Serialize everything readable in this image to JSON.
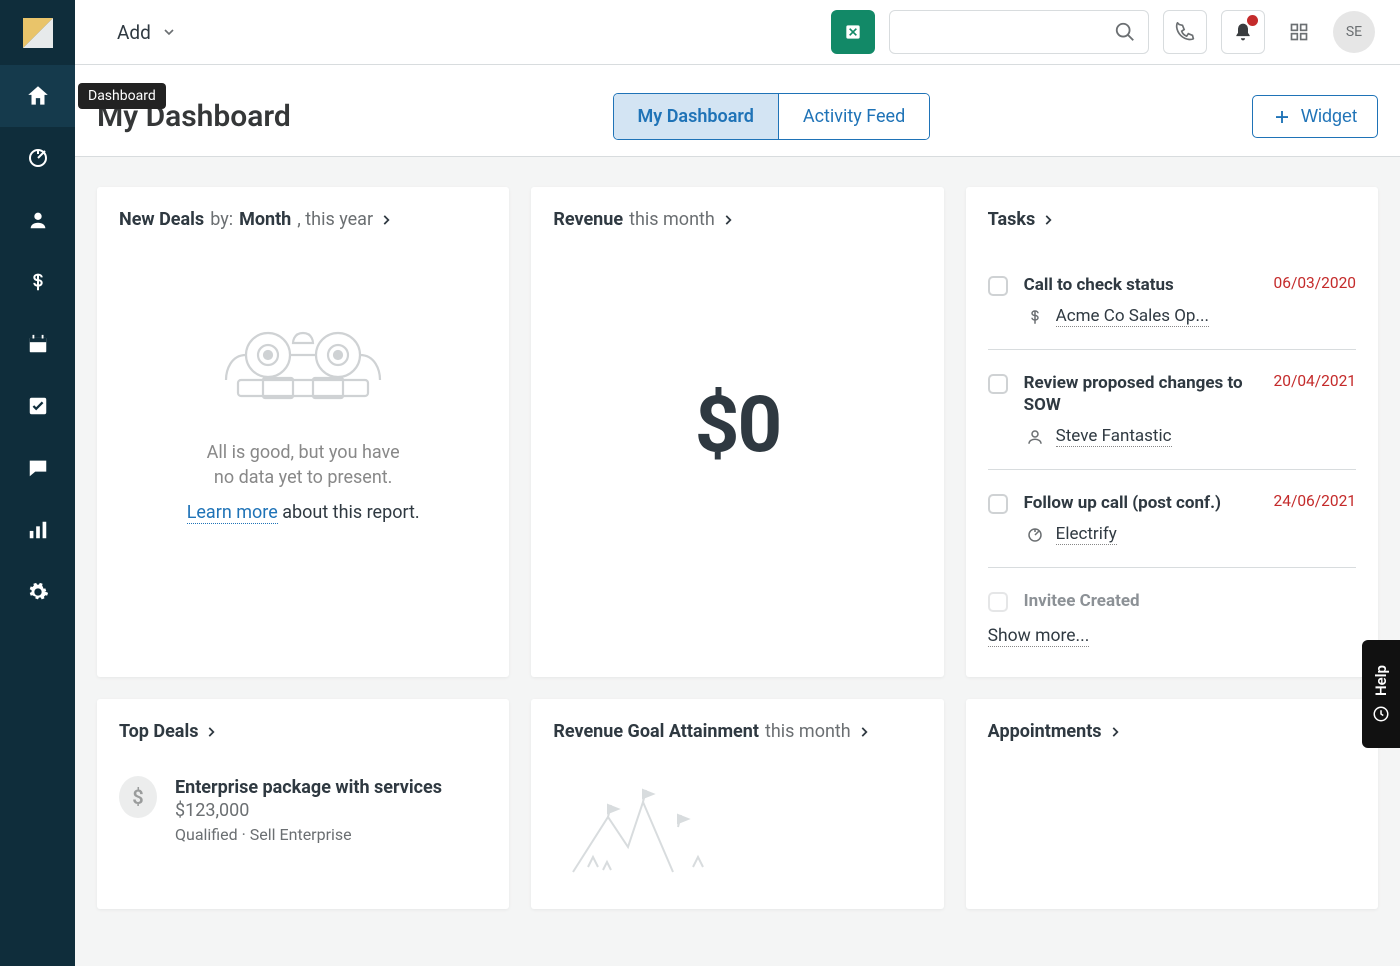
{
  "sidebar": {
    "tooltip": "Dashboard"
  },
  "topbar": {
    "add_label": "Add",
    "avatar_initials": "SE"
  },
  "header": {
    "title": "My Dashboard",
    "tabs": [
      {
        "label": "My Dashboard",
        "active": true
      },
      {
        "label": "Activity Feed",
        "active": false
      }
    ],
    "widget_button": "Widget"
  },
  "cards": {
    "new_deals": {
      "title_bold_1": "New Deals",
      "title_muted_1": "by:",
      "title_bold_2": "Month",
      "title_muted_2": ", this year",
      "empty_line1": "All is good, but you have",
      "empty_line2": "no data yet to present.",
      "learn_more": "Learn more",
      "about": "about this report."
    },
    "revenue": {
      "title_bold": "Revenue",
      "title_muted": "this month",
      "amount": "$0"
    },
    "tasks": {
      "title": "Tasks",
      "items": [
        {
          "name": "Call to check status",
          "date": "06/03/2020",
          "sub_icon": "dollar",
          "sub": "Acme Co Sales Op..."
        },
        {
          "name": "Review proposed changes to SOW",
          "date": "20/04/2021",
          "sub_icon": "person",
          "sub": "Steve Fantastic"
        },
        {
          "name": "Follow up call (post conf.)",
          "date": "24/06/2021",
          "sub_icon": "target",
          "sub": "Electrify"
        }
      ],
      "cut_item": "Invitee Created",
      "show_more": "Show more..."
    },
    "top_deals": {
      "title": "Top Deals",
      "deal_name": "Enterprise package with services",
      "deal_amount": "$123,000",
      "deal_meta": "Qualified · Sell Enterprise"
    },
    "revenue_goal": {
      "title_bold": "Revenue Goal Attainment",
      "title_muted": "this month"
    },
    "appointments": {
      "title": "Appointments"
    }
  },
  "help_tab": "Help"
}
